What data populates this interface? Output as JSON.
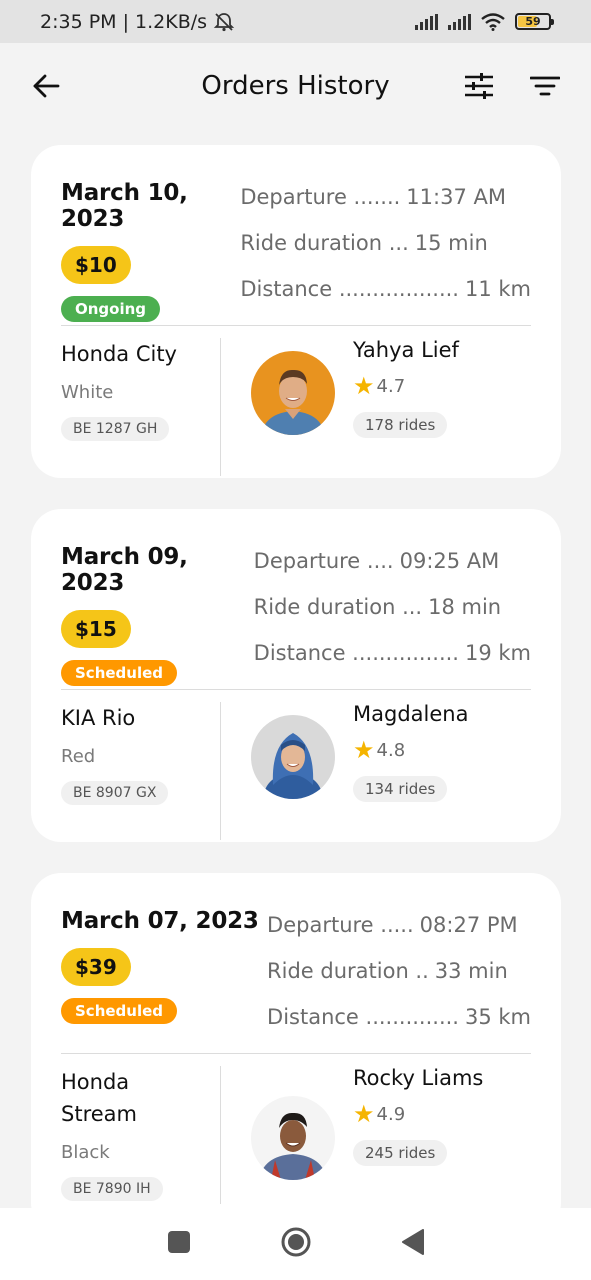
{
  "status_bar": {
    "time_speed": "2:35 PM | 1.2KB/s",
    "battery": "59"
  },
  "header": {
    "title": "Orders History",
    "back_icon": "arrow-left-icon",
    "adjust_icon": "sliders-icon",
    "filter_icon": "filter-icon"
  },
  "orders": [
    {
      "date": "March 10, 2023",
      "price": "$10",
      "status": "Ongoing",
      "status_color": "#4caf50",
      "departure_label": "Departure .......",
      "departure": "11:37 AM",
      "duration_label": "Ride duration ...",
      "duration": "15 min",
      "distance_label": "Distance ..................",
      "distance": "11 km",
      "vehicle": "Honda City",
      "vehicle_color": "White",
      "plate": "BE 1287 GH",
      "driver": "Yahya Lief",
      "rating": "4.7",
      "rides": "178 rides"
    },
    {
      "date": "March 09, 2023",
      "price": "$15",
      "status": "Scheduled",
      "status_color": "#ff9800",
      "departure_label": "Departure ....",
      "departure": "09:25 AM",
      "duration_label": "Ride duration ...",
      "duration": "18 min",
      "distance_label": "Distance ................",
      "distance": "19 km",
      "vehicle": "KIA Rio",
      "vehicle_color": "Red",
      "plate": "BE 8907 GX",
      "driver": "Magdalena",
      "rating": "4.8",
      "rides": "134 rides"
    },
    {
      "date": "March 07, 2023",
      "price": "$39",
      "status": "Scheduled",
      "status_color": "#ff9800",
      "departure_label": "Departure .....",
      "departure": "08:27 PM",
      "duration_label": "Ride duration ..",
      "duration": "33 min",
      "distance_label": "Distance ..............",
      "distance": "35 km",
      "vehicle": "Honda Stream",
      "vehicle_color": "Black",
      "plate": "BE 7890 IH",
      "driver": "Rocky Liams",
      "rating": "4.9",
      "rides": "245 rides"
    }
  ],
  "nav": {
    "recent_icon": "square-icon",
    "home_icon": "circle-icon",
    "back_icon": "triangle-back-icon"
  }
}
